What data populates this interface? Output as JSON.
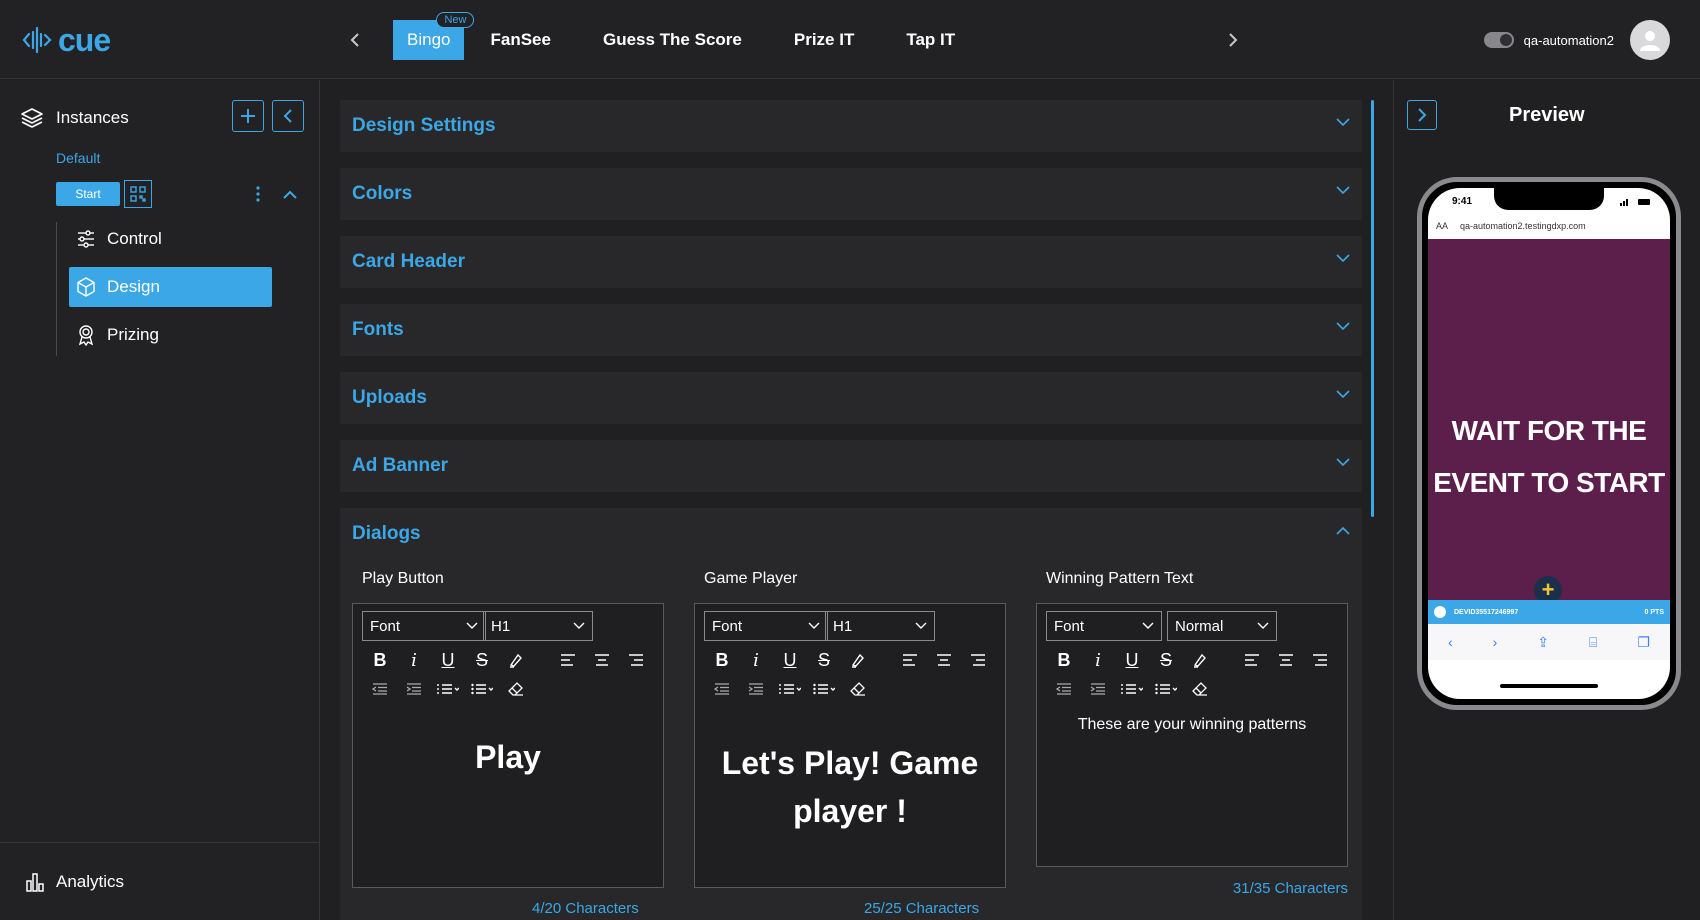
{
  "app": {
    "logo_text": "cue"
  },
  "topbar": {
    "tabs": [
      {
        "label": "Bingo",
        "badge": "New",
        "active": true
      },
      {
        "label": "FanSee"
      },
      {
        "label": "Guess The Score"
      },
      {
        "label": "Prize IT"
      },
      {
        "label": "Tap IT"
      }
    ],
    "username": "qa-automation2"
  },
  "sidebar": {
    "title": "Instances",
    "instance_name": "Default",
    "start_label": "Start",
    "items": [
      {
        "label": "Control",
        "icon": "sliders-icon"
      },
      {
        "label": "Design",
        "icon": "cube-icon",
        "active": true
      },
      {
        "label": "Prizing",
        "icon": "award-icon"
      }
    ],
    "footer_label": "Analytics"
  },
  "main": {
    "sections": [
      "Design Settings",
      "Colors",
      "Card Header",
      "Fonts",
      "Uploads",
      "Ad Banner"
    ],
    "dialogs": {
      "title": "Dialogs",
      "editors": [
        {
          "label": "Play Button",
          "font": "Font",
          "style": "H1",
          "content": "Play",
          "chars": "4/20 Characters"
        },
        {
          "label": "Game Player",
          "font": "Font",
          "style": "H1",
          "content": "Let's Play! Game player !",
          "chars": "25/25 Characters"
        },
        {
          "label": "Winning Pattern Text",
          "font": "Font",
          "style": "Normal",
          "content": "These are your winning patterns",
          "chars": "31/35 Characters"
        }
      ]
    }
  },
  "preview": {
    "title": "Preview",
    "status_time": "9:41",
    "url": "qa-automation2.testingdxp.com",
    "text_size_label": "AA",
    "wait_line1": "WAIT FOR THE",
    "wait_line2": "EVENT TO START",
    "player_id": "DEVID35517246997",
    "points": "0 PTS"
  },
  "colors": {
    "accent": "#3ba7e6",
    "panel": "#28282b",
    "background": "#202022",
    "game_bg": "#5c1f4c"
  }
}
